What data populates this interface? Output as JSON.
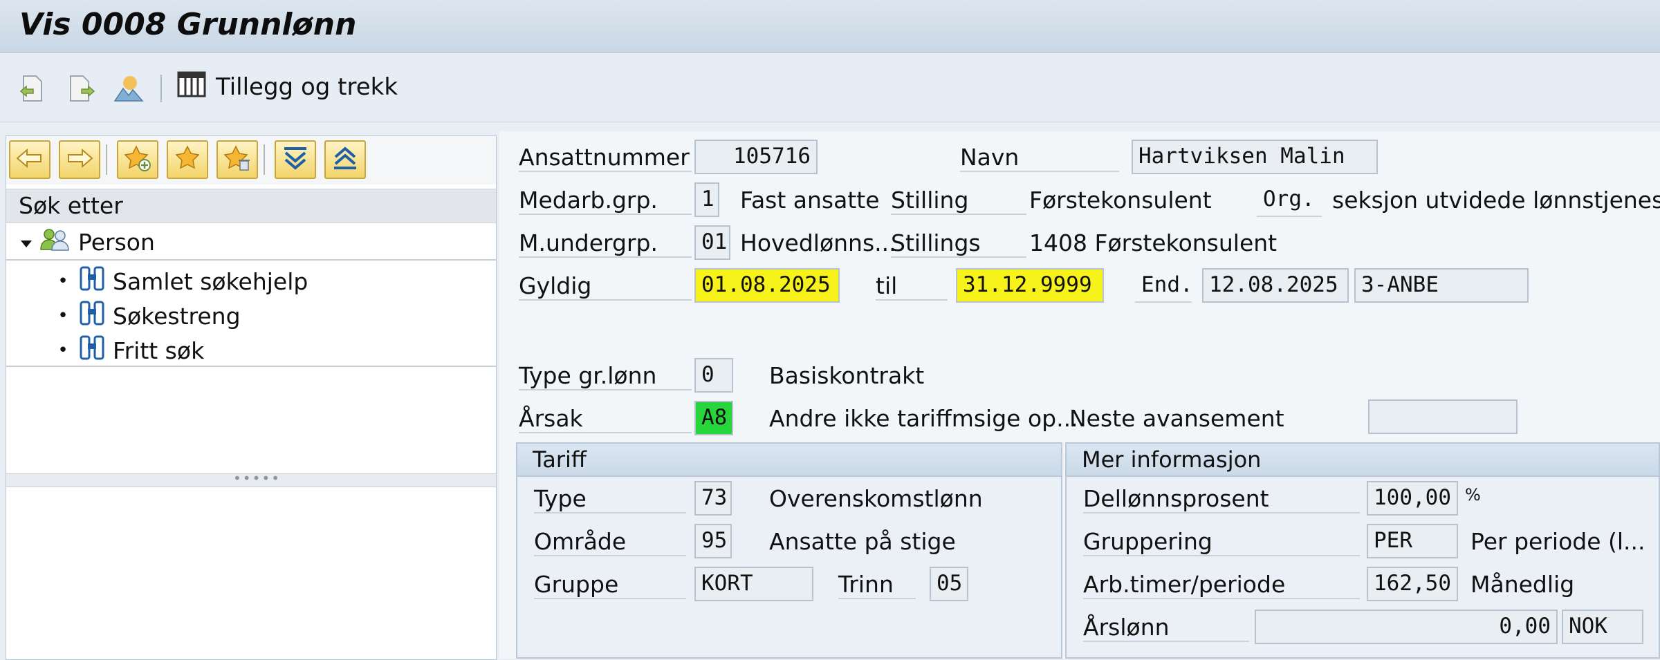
{
  "window": {
    "title": "Vis 0008 Grunnlønn"
  },
  "toolbar": {
    "icons": [
      "previous-record-icon",
      "next-record-icon",
      "mountain-overview-icon"
    ],
    "button_label": "Tillegg og trekk",
    "button_icon": "table-icon"
  },
  "nav": {
    "buttons": [
      "arrow-left-icon",
      "arrow-right-icon",
      "star-add-icon",
      "star-icon",
      "star-delete-icon",
      "expand-all-icon",
      "collapse-all-icon"
    ],
    "search_header": "Søk etter",
    "tree": {
      "root": "Person",
      "items": [
        "Samlet søkehjelp",
        "Søkestreng",
        "Fritt søk"
      ]
    }
  },
  "form": {
    "ansattnummer": {
      "label": "Ansattnummer",
      "value": "105716"
    },
    "navn": {
      "label": "Navn",
      "value": "Hartviksen Malin"
    },
    "medarb_grp": {
      "label": "Medarb.grp.",
      "value": "1",
      "text": "Fast ansatte"
    },
    "stilling": {
      "label": "Stilling",
      "text": "Førstekonsulent"
    },
    "org": {
      "label": "Org.",
      "text": "seksjon utvidede lønnstjenes.."
    },
    "m_undergrp": {
      "label": "M.undergrp.",
      "value": "01",
      "text": "Hovedlønns..."
    },
    "stillings": {
      "label": "Stillings",
      "text": "1408 Førstekonsulent"
    },
    "gyldig": {
      "label": "Gyldig",
      "from": "01.08.2025",
      "til_label": "til",
      "to": "31.12.9999"
    },
    "end": {
      "label": "End.",
      "date": "12.08.2025",
      "user": "3-ANBE"
    },
    "type_gr_lonn": {
      "label": "Type gr.lønn",
      "value": "0",
      "text": "Basiskontrakt"
    },
    "arsak": {
      "label": "Årsak",
      "value": "A8",
      "text": "Andre ikke tariffmsige op..."
    },
    "neste_avansement": {
      "label": "Neste avansement",
      "value": ""
    }
  },
  "tariff": {
    "title": "Tariff",
    "type": {
      "label": "Type",
      "value": "73",
      "text": "Overenskomstlønn"
    },
    "omrade": {
      "label": "Område",
      "value": "95",
      "text": "Ansatte på stige"
    },
    "gruppe": {
      "label": "Gruppe",
      "value": "KORT"
    },
    "trinn": {
      "label": "Trinn",
      "value": "05"
    }
  },
  "mer_info": {
    "title": "Mer informasjon",
    "dellonnsprosent": {
      "label": "Dellønnsprosent",
      "value": "100,00",
      "unit": "%"
    },
    "gruppering": {
      "label": "Gruppering",
      "value": "PER",
      "text": "Per periode (l..."
    },
    "arb_timer": {
      "label": "Arb.timer/periode",
      "value": "162,50",
      "text": "Månedlig"
    },
    "arslonn": {
      "label": "Årslønn",
      "value": "0,00",
      "currency": "NOK"
    }
  },
  "colors": {
    "highlight": "#f7f31a",
    "green": "#27d63a",
    "nav_button": "#f2d46a"
  }
}
